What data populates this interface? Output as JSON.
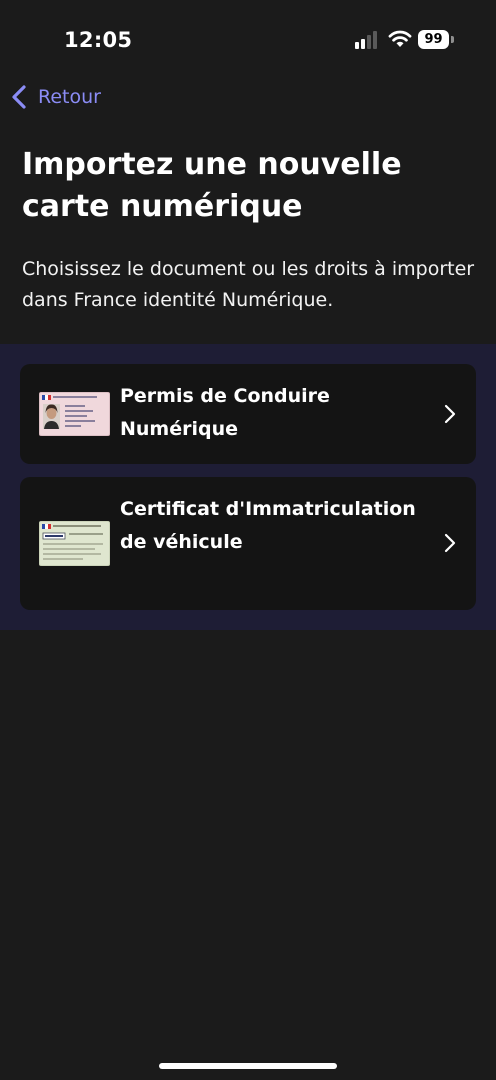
{
  "status_bar": {
    "time": "12:05",
    "battery_level": "99",
    "icons": [
      "signal-icon",
      "wifi-icon",
      "battery-icon"
    ]
  },
  "navigation": {
    "back_label": "Retour",
    "back_icon": "chevron-left-icon"
  },
  "header": {
    "title": "Importez une nouvelle carte numérique",
    "subtitle": "Choisissez le document ou les droits à importer dans France identité Numérique."
  },
  "options": [
    {
      "label": "Permis de Conduire Numérique",
      "icon": "driving-license-card-icon"
    },
    {
      "label": "Certificat d'Immatriculation de véhicule",
      "icon": "vehicle-registration-card-icon"
    }
  ],
  "colors": {
    "background": "#1b1b1b",
    "accent": "#8b8cf5",
    "panel": "#1e1d35",
    "card": "#141414"
  }
}
